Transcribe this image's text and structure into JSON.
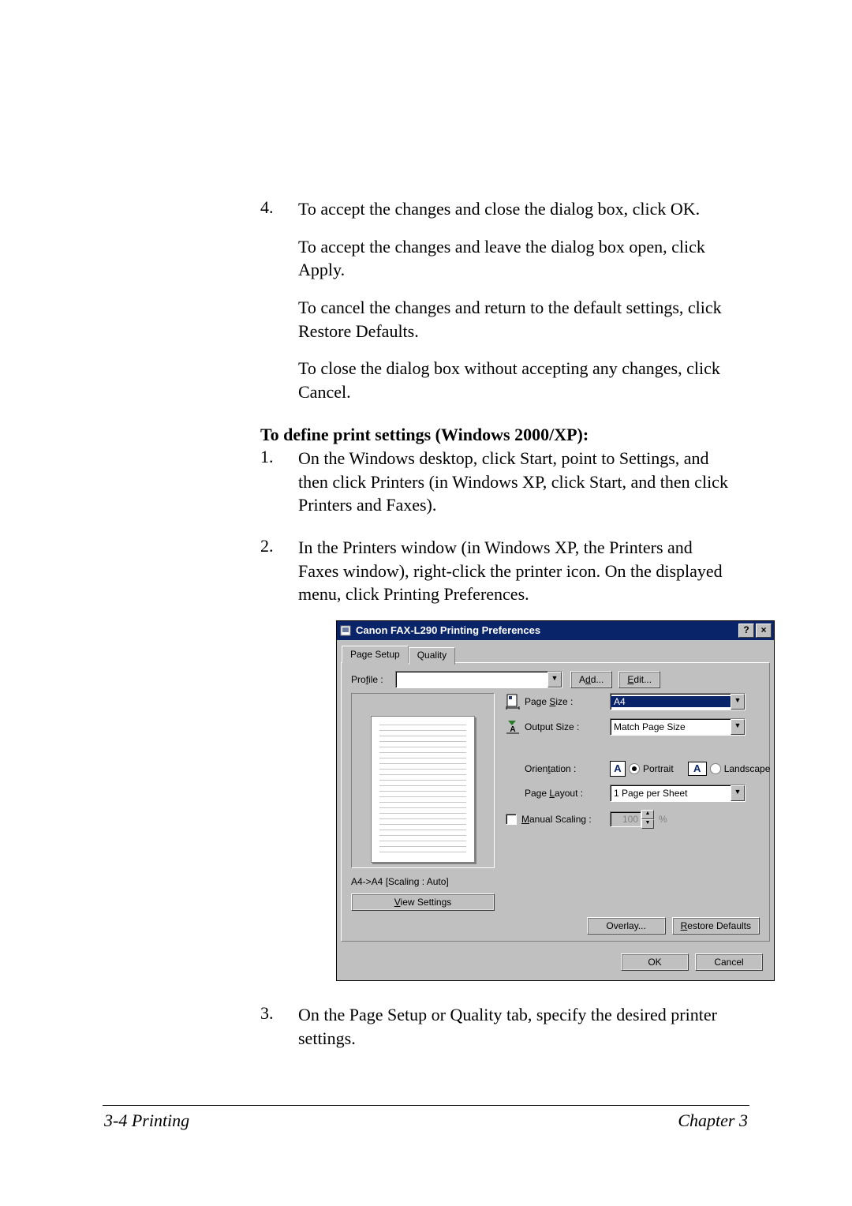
{
  "steps_top": {
    "num4": "4.",
    "s4": "To accept the changes and close the dialog box, click OK.",
    "s4b": "To accept the changes and leave the dialog box open, click Apply.",
    "s4c": "To cancel the changes and return to the default settings, click Restore Defaults.",
    "s4d": "To close the dialog box without accepting any changes, click Cancel."
  },
  "heading": "To define print settings (Windows 2000/XP):",
  "steps_mid": {
    "num1": "1.",
    "s1": "On the Windows desktop, click Start, point to Settings, and then click Printers (in Windows XP, click Start, and then click Printers and Faxes).",
    "num2": "2.",
    "s2": "In the Printers window (in Windows XP, the Printers and Faxes window), right-click the printer icon. On the displayed menu, click Printing Preferences."
  },
  "dialog": {
    "title": "Canon FAX-L290 Printing Preferences",
    "help_btn": "?",
    "close_btn": "×",
    "tabs": {
      "page_setup": "Page Setup",
      "quality": "Quality"
    },
    "profile_label": "Profile :",
    "profile_value": "",
    "add_btn": "Add...",
    "edit_btn": "Edit...",
    "page_size_label": "Page Size :",
    "page_size_value": "A4",
    "output_size_label": "Output Size :",
    "output_size_value": "Match Page Size",
    "orientation_label": "Orientation :",
    "orientation_portrait": "Portrait",
    "orientation_landscape": "Landscape",
    "orient_A": "A",
    "page_layout_label": "Page Layout :",
    "page_layout_value": "1 Page per Sheet",
    "manual_scaling_label": "Manual Scaling :",
    "manual_scaling_value": "100",
    "percent": "%",
    "preview_caption": "A4->A4 [Scaling : Auto]",
    "view_settings_btn": "View Settings",
    "overlay_btn": "Overlay...",
    "restore_btn": "Restore Defaults",
    "ok_btn": "OK",
    "cancel_btn": "Cancel",
    "underlines": {
      "profile": "f",
      "add": "d",
      "edit": "E",
      "page_size": "S",
      "orientation": "t",
      "page_layout": "L",
      "manual_scaling": "M",
      "view_settings": "V",
      "restore": "R"
    }
  },
  "steps_bottom": {
    "num3": "3.",
    "s3": "On the Page Setup or Quality tab, specify the desired printer settings."
  },
  "footer": {
    "left": "3-4   Printing",
    "right": "Chapter 3"
  }
}
